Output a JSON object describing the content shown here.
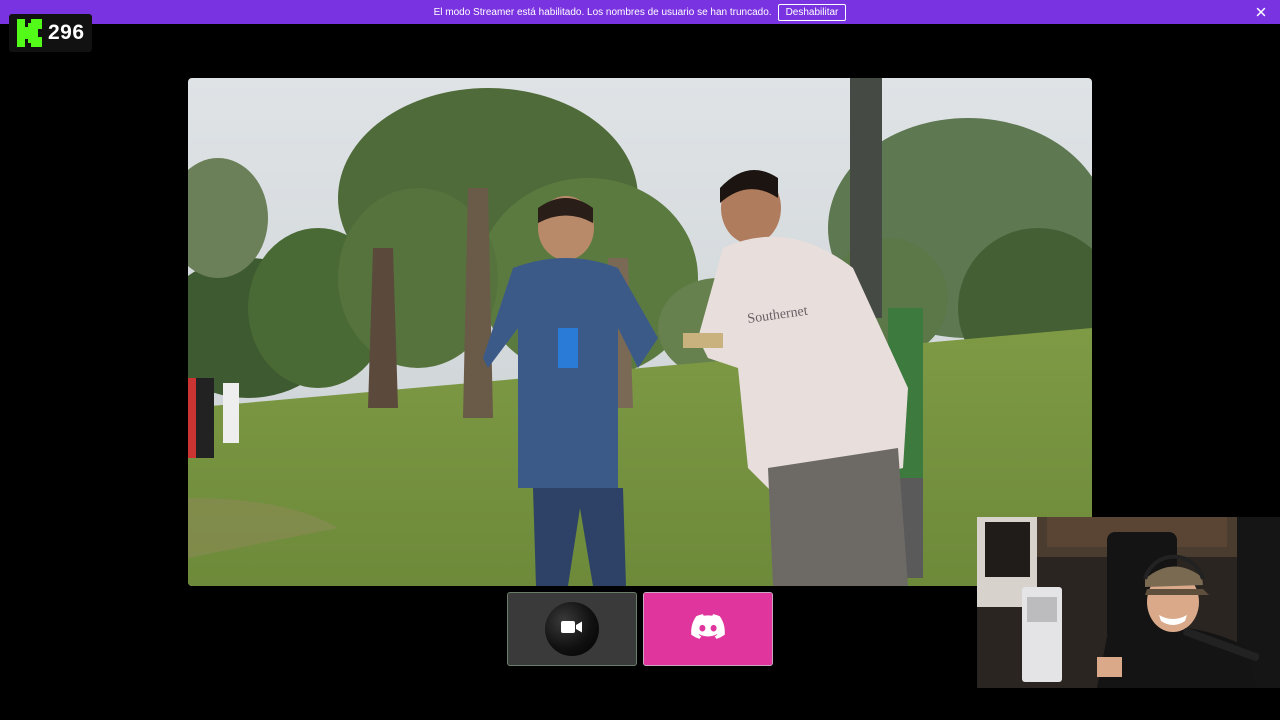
{
  "banner": {
    "message": "El modo Streamer está habilitado. Los nombres de usuario se han truncado.",
    "disable_label": "Deshabilitar",
    "close_icon": "close-icon",
    "color": "#7a33e0"
  },
  "badge": {
    "logo_icon": "kick-logo",
    "viewer_count": "296",
    "accent": "#53fc18"
  },
  "main_video": {
    "content": "park-scene"
  },
  "controls": {
    "camera_icon": "video-camera-icon",
    "discord_icon": "discord-icon",
    "discord_color": "#e0359c"
  },
  "webcam": {
    "content": "streamer-webcam"
  }
}
